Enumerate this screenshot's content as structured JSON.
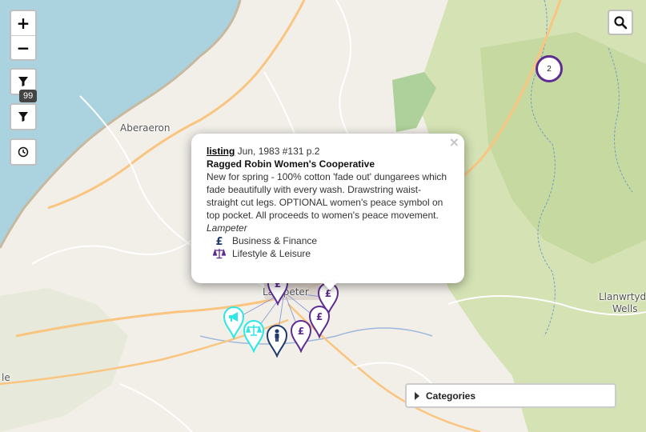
{
  "map": {
    "place_labels": {
      "aberaeron": "Aberaeron",
      "lampeter": "Lampeter",
      "llanwrtyd_line1": "Llanwrtyd",
      "llanwrtyd_line2": "Wells",
      "partial_left": "le"
    },
    "colors": {
      "sea": "#aad3df",
      "land": "#f2efe9",
      "forest": "#c8dba6",
      "road_major": "#f9c580",
      "road_minor": "#ffffff",
      "river": "#7a9cc8"
    }
  },
  "zoom_controls": {
    "zoom_in": "+",
    "zoom_out": "−"
  },
  "filters": {
    "filter_icon": "filter-icon",
    "count_badge": "99",
    "history_icon": "clock-icon"
  },
  "search": {
    "icon": "search-icon"
  },
  "cluster": {
    "count": "2",
    "color": "#5e2d91"
  },
  "markers": [
    {
      "category": "Business & Finance",
      "icon": "pound-sign",
      "color": "#5e2d91",
      "glyph": "£"
    },
    {
      "category": "Business & Finance",
      "icon": "pound-sign",
      "color": "#5e2d91",
      "glyph": "£"
    },
    {
      "category": "Business & Finance",
      "icon": "pound-sign",
      "color": "#5e2d91",
      "glyph": "£"
    },
    {
      "category": "Business & Finance",
      "icon": "pound-sign",
      "color": "#5e2d91",
      "glyph": "£"
    },
    {
      "category": "Campaigns",
      "icon": "megaphone",
      "color": "#2ee6e6",
      "glyph": ""
    },
    {
      "category": "Lifestyle & Leisure",
      "icon": "balance-scale",
      "color": "#2ee6e6",
      "glyph": ""
    },
    {
      "category": "Person",
      "icon": "person",
      "color": "#1f3a6b",
      "glyph": ""
    }
  ],
  "popup": {
    "close": "×",
    "link": "listing",
    "meta": " Jun, 1983 #131 p.2",
    "title": "Ragged Robin Women's Cooperative",
    "body": "New for spring - 100% cotton 'fade out' dungarees which fade beautifully with every wash. Drawstring waist-straight cut legs. OPTIONAL women's peace symbol on top pocket. All proceeds to women's peace movement.",
    "place": "Lampeter",
    "categories": [
      {
        "label": "Business & Finance",
        "icon": "pound-icon",
        "color": "#1f3a6b"
      },
      {
        "label": "Lifestyle & Leisure",
        "icon": "balance-scale-icon",
        "color": "#5e2d91"
      }
    ]
  },
  "categories_panel": {
    "label": "Categories"
  }
}
